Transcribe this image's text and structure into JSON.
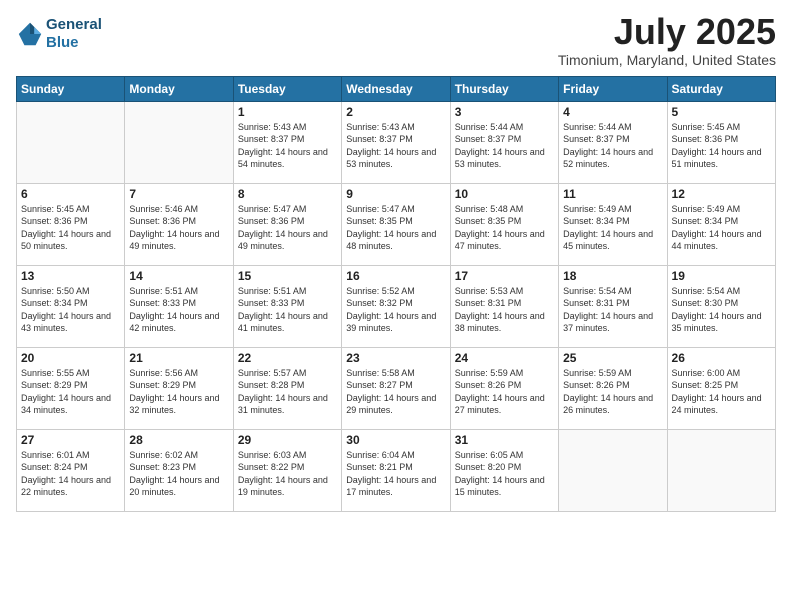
{
  "logo": {
    "line1": "General",
    "line2": "Blue"
  },
  "title": "July 2025",
  "location": "Timonium, Maryland, United States",
  "days_of_week": [
    "Sunday",
    "Monday",
    "Tuesday",
    "Wednesday",
    "Thursday",
    "Friday",
    "Saturday"
  ],
  "weeks": [
    [
      {
        "day": "",
        "sunrise": "",
        "sunset": "",
        "daylight": ""
      },
      {
        "day": "",
        "sunrise": "",
        "sunset": "",
        "daylight": ""
      },
      {
        "day": "1",
        "sunrise": "Sunrise: 5:43 AM",
        "sunset": "Sunset: 8:37 PM",
        "daylight": "Daylight: 14 hours and 54 minutes."
      },
      {
        "day": "2",
        "sunrise": "Sunrise: 5:43 AM",
        "sunset": "Sunset: 8:37 PM",
        "daylight": "Daylight: 14 hours and 53 minutes."
      },
      {
        "day": "3",
        "sunrise": "Sunrise: 5:44 AM",
        "sunset": "Sunset: 8:37 PM",
        "daylight": "Daylight: 14 hours and 53 minutes."
      },
      {
        "day": "4",
        "sunrise": "Sunrise: 5:44 AM",
        "sunset": "Sunset: 8:37 PM",
        "daylight": "Daylight: 14 hours and 52 minutes."
      },
      {
        "day": "5",
        "sunrise": "Sunrise: 5:45 AM",
        "sunset": "Sunset: 8:36 PM",
        "daylight": "Daylight: 14 hours and 51 minutes."
      }
    ],
    [
      {
        "day": "6",
        "sunrise": "Sunrise: 5:45 AM",
        "sunset": "Sunset: 8:36 PM",
        "daylight": "Daylight: 14 hours and 50 minutes."
      },
      {
        "day": "7",
        "sunrise": "Sunrise: 5:46 AM",
        "sunset": "Sunset: 8:36 PM",
        "daylight": "Daylight: 14 hours and 49 minutes."
      },
      {
        "day": "8",
        "sunrise": "Sunrise: 5:47 AM",
        "sunset": "Sunset: 8:36 PM",
        "daylight": "Daylight: 14 hours and 49 minutes."
      },
      {
        "day": "9",
        "sunrise": "Sunrise: 5:47 AM",
        "sunset": "Sunset: 8:35 PM",
        "daylight": "Daylight: 14 hours and 48 minutes."
      },
      {
        "day": "10",
        "sunrise": "Sunrise: 5:48 AM",
        "sunset": "Sunset: 8:35 PM",
        "daylight": "Daylight: 14 hours and 47 minutes."
      },
      {
        "day": "11",
        "sunrise": "Sunrise: 5:49 AM",
        "sunset": "Sunset: 8:34 PM",
        "daylight": "Daylight: 14 hours and 45 minutes."
      },
      {
        "day": "12",
        "sunrise": "Sunrise: 5:49 AM",
        "sunset": "Sunset: 8:34 PM",
        "daylight": "Daylight: 14 hours and 44 minutes."
      }
    ],
    [
      {
        "day": "13",
        "sunrise": "Sunrise: 5:50 AM",
        "sunset": "Sunset: 8:34 PM",
        "daylight": "Daylight: 14 hours and 43 minutes."
      },
      {
        "day": "14",
        "sunrise": "Sunrise: 5:51 AM",
        "sunset": "Sunset: 8:33 PM",
        "daylight": "Daylight: 14 hours and 42 minutes."
      },
      {
        "day": "15",
        "sunrise": "Sunrise: 5:51 AM",
        "sunset": "Sunset: 8:33 PM",
        "daylight": "Daylight: 14 hours and 41 minutes."
      },
      {
        "day": "16",
        "sunrise": "Sunrise: 5:52 AM",
        "sunset": "Sunset: 8:32 PM",
        "daylight": "Daylight: 14 hours and 39 minutes."
      },
      {
        "day": "17",
        "sunrise": "Sunrise: 5:53 AM",
        "sunset": "Sunset: 8:31 PM",
        "daylight": "Daylight: 14 hours and 38 minutes."
      },
      {
        "day": "18",
        "sunrise": "Sunrise: 5:54 AM",
        "sunset": "Sunset: 8:31 PM",
        "daylight": "Daylight: 14 hours and 37 minutes."
      },
      {
        "day": "19",
        "sunrise": "Sunrise: 5:54 AM",
        "sunset": "Sunset: 8:30 PM",
        "daylight": "Daylight: 14 hours and 35 minutes."
      }
    ],
    [
      {
        "day": "20",
        "sunrise": "Sunrise: 5:55 AM",
        "sunset": "Sunset: 8:29 PM",
        "daylight": "Daylight: 14 hours and 34 minutes."
      },
      {
        "day": "21",
        "sunrise": "Sunrise: 5:56 AM",
        "sunset": "Sunset: 8:29 PM",
        "daylight": "Daylight: 14 hours and 32 minutes."
      },
      {
        "day": "22",
        "sunrise": "Sunrise: 5:57 AM",
        "sunset": "Sunset: 8:28 PM",
        "daylight": "Daylight: 14 hours and 31 minutes."
      },
      {
        "day": "23",
        "sunrise": "Sunrise: 5:58 AM",
        "sunset": "Sunset: 8:27 PM",
        "daylight": "Daylight: 14 hours and 29 minutes."
      },
      {
        "day": "24",
        "sunrise": "Sunrise: 5:59 AM",
        "sunset": "Sunset: 8:26 PM",
        "daylight": "Daylight: 14 hours and 27 minutes."
      },
      {
        "day": "25",
        "sunrise": "Sunrise: 5:59 AM",
        "sunset": "Sunset: 8:26 PM",
        "daylight": "Daylight: 14 hours and 26 minutes."
      },
      {
        "day": "26",
        "sunrise": "Sunrise: 6:00 AM",
        "sunset": "Sunset: 8:25 PM",
        "daylight": "Daylight: 14 hours and 24 minutes."
      }
    ],
    [
      {
        "day": "27",
        "sunrise": "Sunrise: 6:01 AM",
        "sunset": "Sunset: 8:24 PM",
        "daylight": "Daylight: 14 hours and 22 minutes."
      },
      {
        "day": "28",
        "sunrise": "Sunrise: 6:02 AM",
        "sunset": "Sunset: 8:23 PM",
        "daylight": "Daylight: 14 hours and 20 minutes."
      },
      {
        "day": "29",
        "sunrise": "Sunrise: 6:03 AM",
        "sunset": "Sunset: 8:22 PM",
        "daylight": "Daylight: 14 hours and 19 minutes."
      },
      {
        "day": "30",
        "sunrise": "Sunrise: 6:04 AM",
        "sunset": "Sunset: 8:21 PM",
        "daylight": "Daylight: 14 hours and 17 minutes."
      },
      {
        "day": "31",
        "sunrise": "Sunrise: 6:05 AM",
        "sunset": "Sunset: 8:20 PM",
        "daylight": "Daylight: 14 hours and 15 minutes."
      },
      {
        "day": "",
        "sunrise": "",
        "sunset": "",
        "daylight": ""
      },
      {
        "day": "",
        "sunrise": "",
        "sunset": "",
        "daylight": ""
      }
    ]
  ]
}
